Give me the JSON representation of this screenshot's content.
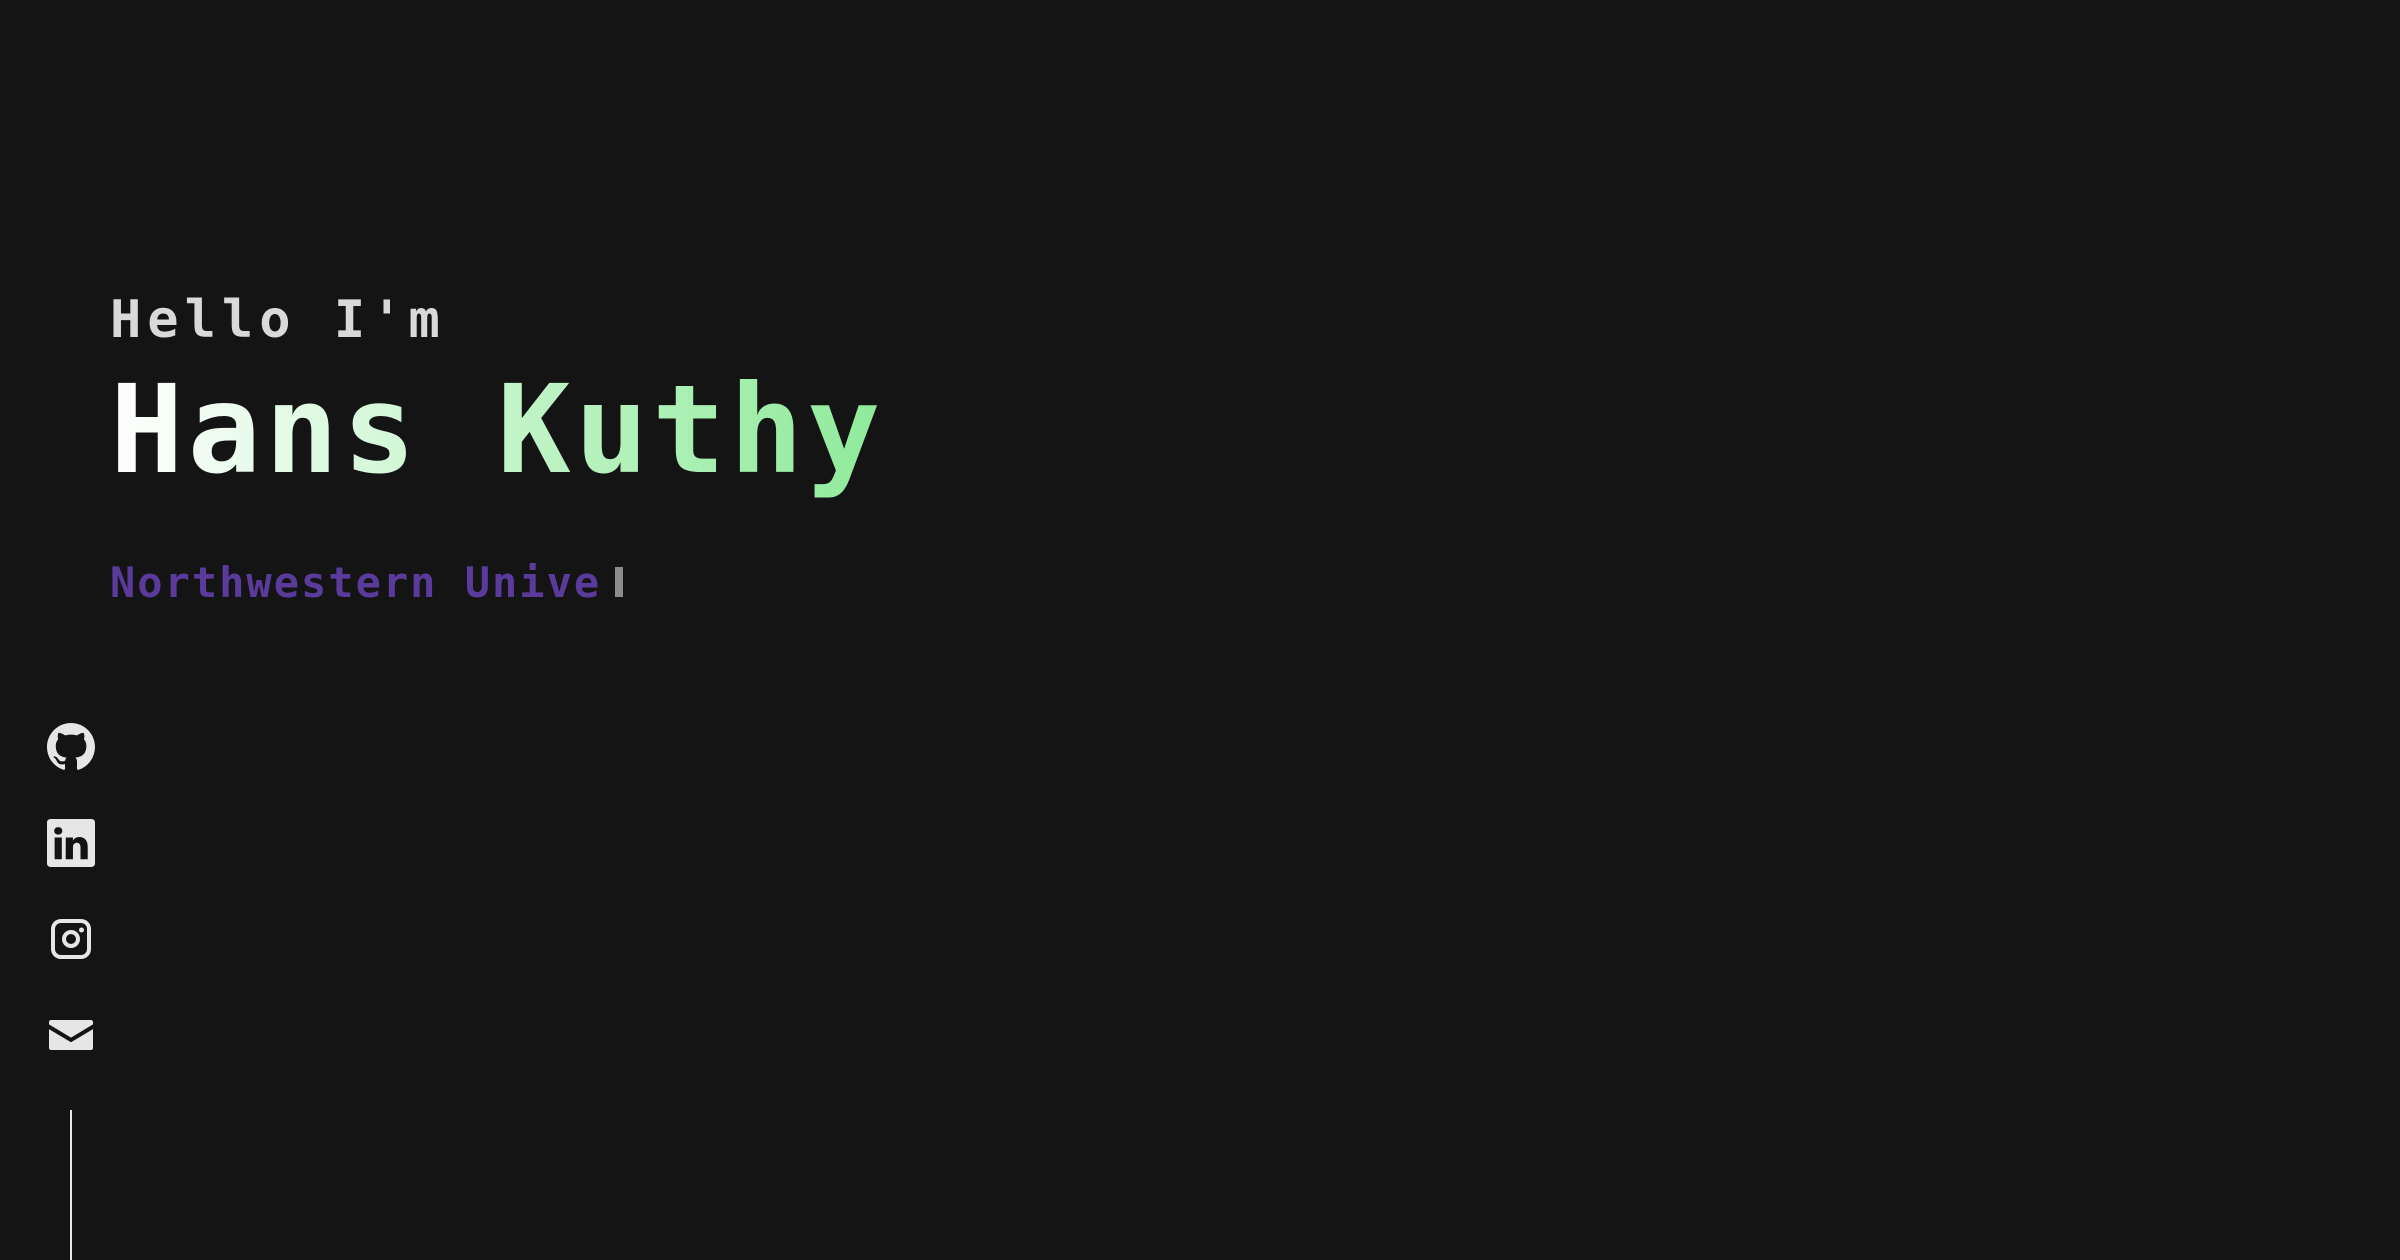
{
  "hero": {
    "greeting": "Hello I'm",
    "name": "Hans Kuthy",
    "typing_text": "Northwestern Unive"
  },
  "colors": {
    "background": "#141415",
    "greeting": "#d9d9d9",
    "name_gradient_start": "#ffffff",
    "name_gradient_end": "#8fea9a",
    "typing_text": "#5a3a9a",
    "caret": "#8c8c8c",
    "social_icons": "#e6e6e6"
  },
  "social": {
    "icons": [
      "github-icon",
      "linkedin-icon",
      "instagram-icon",
      "email-icon"
    ]
  }
}
